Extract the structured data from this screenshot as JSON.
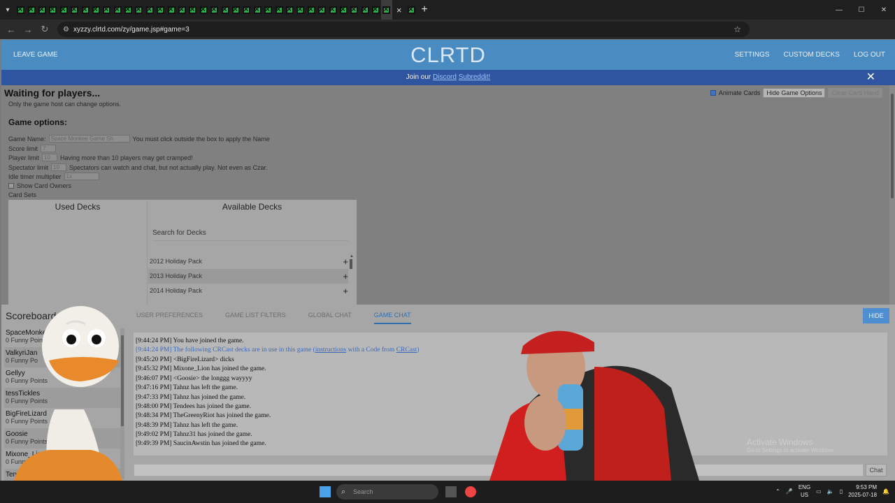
{
  "browser": {
    "url": "xyzzy.clrtd.com/zy/game.jsp#game=3",
    "tab_count": 35
  },
  "site": {
    "leave_label": "LEAVE GAME",
    "logo": "CLRTD",
    "nav": [
      "SETTINGS",
      "CUSTOM DECKS",
      "LOG OUT"
    ],
    "banner_prefix": "Join our ",
    "banner_link1": "Discord",
    "banner_link2": "Subreddit!"
  },
  "game": {
    "status": "Waiting for players...",
    "host_note": "Only the game host can change options.",
    "options_title": "Game options:",
    "game_name_label": "Game Name:",
    "game_name_value": "Space Monkee Game Sh",
    "game_name_hint": "You must click outside the box to apply the Name",
    "score_limit_label": "Score limit",
    "score_limit_value": "7",
    "player_limit_label": "Player limit",
    "player_limit_value": "10",
    "player_limit_hint": "Having more than 10 players may get cramped!",
    "spectator_limit_label": "Spectator limit",
    "spectator_limit_value": "10",
    "spectator_hint": "Spectators can watch and chat, but not actually play. Not even as Czar.",
    "idle_label": "Idle timer multiplier",
    "idle_value": "1x",
    "show_owners": "Show Card Owners",
    "card_sets": "Card Sets",
    "animate_cards": "Animate Cards",
    "hide_options": "Hide Game Options",
    "clear_hand": "Clear Card Hand"
  },
  "decks": {
    "used_title": "Used Decks",
    "available_title": "Available Decks",
    "search_placeholder": "Search for Decks",
    "items": [
      "2012 Holiday Pack",
      "2013 Holiday Pack",
      "2014 Holiday Pack"
    ]
  },
  "panel": {
    "scoreboard_title": "Scoreboard",
    "tabs": [
      "USER PREFERENCES",
      "GAME LIST FILTERS",
      "GLOBAL CHAT",
      "GAME CHAT"
    ],
    "active_tab": "GAME CHAT",
    "hide_label": "HIDE",
    "players": [
      {
        "name": "SpaceMonke",
        "points": "0 Funny Points"
      },
      {
        "name": "ValkyriJan",
        "points": "0 Funny Po"
      },
      {
        "name": "Gellyy",
        "points": "0 Funny Points"
      },
      {
        "name": "tessTickles",
        "points": "0 Funny Points"
      },
      {
        "name": "BigFireLizard",
        "points": "0 Funny Points"
      },
      {
        "name": "Goosie",
        "points": "0 Funny Points"
      },
      {
        "name": "Mixone_Lio",
        "points": "0 Funny P"
      },
      {
        "name": "Tende",
        "points": ""
      }
    ],
    "chat": [
      {
        "text": "[9:44:24 PM] You have joined the game."
      },
      {
        "text": "[9:44:24 PM] The following ",
        "link1": "CRCast",
        "mid": " decks are in use in this game (",
        "link2": "instructions",
        "end": " with a Code from ",
        "link3": "CRCast",
        "tail": ")"
      },
      {
        "text": "[9:45:20 PM] <BigFireLizard> dicks"
      },
      {
        "text": "[9:45:32 PM] Mixone_Lion has joined the game."
      },
      {
        "text": "[9:46:07 PM] <Goosie> the longgg wayyyy"
      },
      {
        "text": "[9:47:16 PM] Tahnz has left the game."
      },
      {
        "text": "[9:47:33 PM] Tahnz has joined the game."
      },
      {
        "text": "[9:48:00 PM] Tendees has joined the game."
      },
      {
        "text": "[9:48:34 PM] TheGreenyRiot has joined the game."
      },
      {
        "text": "[9:48:39 PM] Tahnz has left the game."
      },
      {
        "text": "[9:49:02 PM] Tahnz31 has joined the game."
      },
      {
        "text": "[9:49:39 PM] SaucinAwstin has joined the game."
      }
    ],
    "chat_button": "Chat",
    "activate_title": "Activate Windows",
    "activate_sub": "Go to Settings to activate Windows."
  },
  "taskbar": {
    "search_placeholder": "Search",
    "lang1": "ENG",
    "lang2": "US",
    "time": "9:53 PM",
    "date": "2025-07-18"
  }
}
